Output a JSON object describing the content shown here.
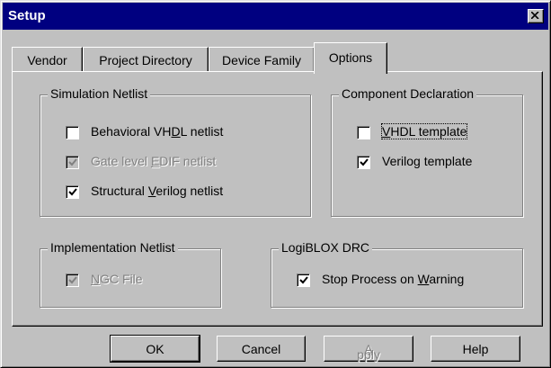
{
  "window": {
    "title": "Setup"
  },
  "tabs": [
    {
      "label": "Vendor"
    },
    {
      "label": "Project Directory"
    },
    {
      "label": "Device Family"
    },
    {
      "label": "Options",
      "active": true
    }
  ],
  "groups": {
    "simulation": {
      "title": "Simulation Netlist",
      "items": [
        {
          "pre": "Behavioral VH",
          "key": "D",
          "post": "L netlist",
          "checked": false,
          "disabled": false
        },
        {
          "pre": "Gate level ",
          "key": "E",
          "post": "DIF netlist",
          "checked": true,
          "disabled": true
        },
        {
          "pre": "Structural ",
          "key": "V",
          "post": "erilog netlist",
          "checked": true,
          "disabled": false
        }
      ]
    },
    "component": {
      "title": "Component Declaration",
      "items": [
        {
          "pre": "",
          "key": "V",
          "post": "HDL template",
          "checked": false,
          "disabled": false,
          "focused": true
        },
        {
          "pre": "Verilog template",
          "key": "",
          "post": "",
          "checked": true,
          "disabled": false
        }
      ]
    },
    "implementation": {
      "title": "Implementation Netlist",
      "items": [
        {
          "pre": "",
          "key": "N",
          "post": "GC File",
          "checked": true,
          "disabled": true
        }
      ]
    },
    "logiblox": {
      "title": "LogiBLOX DRC",
      "items": [
        {
          "pre": "Stop Process on ",
          "key": "W",
          "post": "arning",
          "checked": true,
          "disabled": false
        }
      ]
    }
  },
  "buttons": {
    "ok": "OK",
    "cancel": "Cancel",
    "apply_pre": "",
    "apply_key": "A",
    "apply_post": "pply",
    "help": "Help"
  },
  "icons": {
    "close": "close-icon",
    "check": "checkmark-icon"
  },
  "colors": {
    "titlebar": "#000080",
    "face": "#c0c0c0",
    "disabled_text": "#808080"
  }
}
